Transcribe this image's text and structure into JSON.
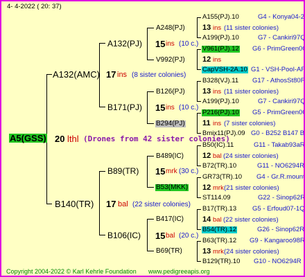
{
  "header": {
    "date": "4-  4-2022 ( 20: 37)"
  },
  "root": {
    "label": "A5(GSS)",
    "num": "20",
    "ins": "lthl",
    "note": "(Drones from 42 sister colonies)"
  },
  "g1": [
    {
      "label": "A132(AMC)",
      "num": "17",
      "ins": "ins",
      "note": "(8 sister colonies)"
    },
    {
      "label": "B140(TR)",
      "num": "17",
      "ins": "bal",
      "note": "(22 sister colonies)"
    }
  ],
  "g2": [
    {
      "label": "A132(PJ)",
      "num": "15",
      "ins": "ins",
      "note": "(10 c.)"
    },
    {
      "label": "B171(PJ)",
      "num": "15",
      "ins": "ins",
      "note": "(10 c.)"
    },
    {
      "label": "B89(TR)",
      "num": "15",
      "ins": "mrk",
      "note": "(30 c.)"
    },
    {
      "label": "B106(IC)",
      "num": "15",
      "ins": "bal",
      "note": "(20 c.)"
    }
  ],
  "g3": [
    {
      "label": "A248(PJ)",
      "num": "13",
      "ins": "ins",
      "note": "(11 sister colonies)"
    },
    {
      "label": "V992(PJ)",
      "num": "12",
      "ins": "ins",
      "note": ""
    },
    {
      "label": "B126(PJ)",
      "num": "13",
      "ins": "ins",
      "note": "(11 sister colonies)"
    },
    {
      "label": "B294(PJ)",
      "num": "11",
      "ins": "ins",
      "note": "(7 sister colonies)"
    },
    {
      "label": "B489(IC)",
      "num": "12",
      "ins": "bal",
      "note": "(24 sister colonies)"
    },
    {
      "label": "B53(MKK)",
      "num": "12",
      "ins": "mrk",
      "note": "(21 sister colonies)"
    },
    {
      "label": "B417(IC)",
      "num": "14",
      "ins": "bal",
      "note": "(22 sister colonies)"
    },
    {
      "label": "B69(TR)",
      "num": "13",
      "ins": "mrk",
      "note": "(24 sister colonies)"
    }
  ],
  "g4": [
    {
      "label": "A155(PJ).10",
      "tag": "G4 - Konya04-2"
    },
    {
      "label": "A199(PJ).10",
      "tag": "G7 - Cankiri97Q"
    },
    {
      "label": "V961(PJ).12",
      "tag": "G6 - PrimGreen00"
    },
    {
      "label": "CapVSH-2A.10",
      "tag": "G1 - VSH-Pool-AR"
    },
    {
      "label": "B328(VJ).11",
      "tag": "G17 - AthosSt80R"
    },
    {
      "label": "A199(PJ).10",
      "tag": "G7 - Cankiri97Q"
    },
    {
      "label": "P216(PJ).10",
      "tag": "G5 - PrimGreen00"
    },
    {
      "label": "Bmix11(PJ).09",
      "tag": "G0 - B252 B147 B"
    },
    {
      "label": "B50(IC).11",
      "tag": "G11 - Takab93aR"
    },
    {
      "label": "B72(TR).10",
      "tag": "G11 - NO6294R"
    },
    {
      "label": "GR73(TR).10",
      "tag": "G4 - Gr.R.mounta"
    },
    {
      "label": "ST114.09",
      "tag": "G22 - Sinop62R"
    },
    {
      "label": "B17(TR).13",
      "tag": "G5 - Erfoud07-1Q"
    },
    {
      "label": "B54(TR).12",
      "tag": "G26 - Sinop62R"
    },
    {
      "label": "B63(TR).12",
      "tag": "G9 - Kangaroo98R"
    },
    {
      "label": "B129(TR).10",
      "tag": "G10 - NO6294R"
    }
  ],
  "footer": {
    "copyright": "Copyright 2004-2022 © Karl Kehrle Foundation",
    "url": "www.pedigreeapis.org"
  },
  "colors": {
    "border": "#e000e0",
    "background": "#ffffc4",
    "highlight_green": "#22c622",
    "highlight_cyan": "#00cccc",
    "highlight_grey": "#bdbdbd",
    "green_text": "#008800",
    "blue_text": "#1818cc",
    "red_text": "#cc0000"
  }
}
